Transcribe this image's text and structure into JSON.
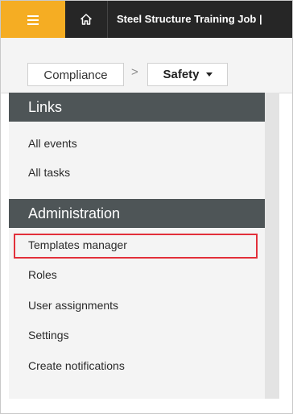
{
  "topbar": {
    "menu_icon": "hamburger-menu-icon",
    "home_icon": "home-icon",
    "project_title": "Steel Structure Training Job |",
    "accent_color": "#f5ad23"
  },
  "breadcrumb": {
    "items": [
      {
        "label": "Compliance"
      },
      {
        "label": "Safety"
      }
    ],
    "separator": ">",
    "dropdown_icon": "caret-down-icon"
  },
  "sidebar": {
    "sections": [
      {
        "title": "Links",
        "items": [
          "All events",
          "All tasks"
        ]
      },
      {
        "title": "Administration",
        "items": [
          "Templates manager",
          "Roles",
          "User assignments",
          "Settings",
          "Create notifications"
        ]
      }
    ],
    "highlighted_item": "Templates manager",
    "highlight_color": "#e2303a",
    "header_color": "#4e5557"
  }
}
